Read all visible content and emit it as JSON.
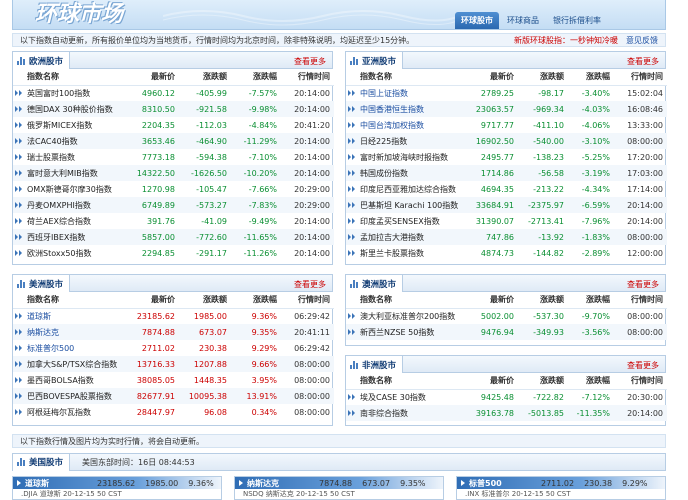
{
  "banner": {
    "logo": "环球市场",
    "tabs": [
      "环球股市",
      "环球商品",
      "银行拆借利率"
    ]
  },
  "notice": {
    "text": "以下指数自动更新，所有报价单位均为当地货币，行情时间均为北京时间，除非特殊说明，均延迟至少15分钟。",
    "link1": "新版环球股指：一秒钟知冷暖",
    "link2": "意见反馈"
  },
  "more_label": "查看更多",
  "headers": [
    "指数名称",
    "最新价",
    "涨跌额",
    "涨跌幅",
    "行情时间"
  ],
  "europe": {
    "title": "欧洲股市",
    "rows": [
      [
        "英国富时100指数",
        "4960.12",
        "-405.99",
        "-7.57%",
        "20:14:00"
      ],
      [
        "德国DAX 30种股价指数",
        "8310.50",
        "-921.58",
        "-9.98%",
        "20:14:00"
      ],
      [
        "俄罗斯MICEX指数",
        "2204.35",
        "-112.03",
        "-4.84%",
        "20:41:20"
      ],
      [
        "法CAC40指数",
        "3653.46",
        "-464.90",
        "-11.29%",
        "20:14:00"
      ],
      [
        "瑞士股票指数",
        "7773.18",
        "-594.38",
        "-7.10%",
        "20:14:00"
      ],
      [
        "富时意大利MIB指数",
        "14322.50",
        "-1626.50",
        "-10.20%",
        "20:14:00"
      ],
      [
        "OMX斯德哥尔摩30指数",
        "1270.98",
        "-105.47",
        "-7.66%",
        "20:29:00"
      ],
      [
        "丹麦OMXPHI指数",
        "6749.89",
        "-573.27",
        "-7.83%",
        "20:29:00"
      ],
      [
        "荷兰AEX综合指数",
        "391.76",
        "-41.09",
        "-9.49%",
        "20:14:00"
      ],
      [
        "西班牙IBEX指数",
        "5857.00",
        "-772.60",
        "-11.65%",
        "20:14:00"
      ],
      [
        "欧洲Stoxx50指数",
        "2294.85",
        "-291.17",
        "-11.26%",
        "20:14:00"
      ]
    ]
  },
  "asia": {
    "title": "亚洲股市",
    "rows": [
      [
        "中国上证指数",
        "2789.25",
        "-98.17",
        "-3.40%",
        "15:02:04"
      ],
      [
        "中国香港恒生指数",
        "23063.57",
        "-969.34",
        "-4.03%",
        "16:08:46"
      ],
      [
        "中国台湾加权指数",
        "9717.77",
        "-411.10",
        "-4.06%",
        "13:33:00"
      ],
      [
        "日经225指数",
        "16902.50",
        "-540.00",
        "-3.10%",
        "08:00:00"
      ],
      [
        "富时新加坡海峡时报指数",
        "2495.77",
        "-138.23",
        "-5.25%",
        "17:20:00"
      ],
      [
        "韩国成份指数",
        "1714.86",
        "-56.58",
        "-3.19%",
        "17:03:00"
      ],
      [
        "印度尼西亚雅加达综合指数",
        "4694.35",
        "-213.22",
        "-4.34%",
        "17:14:00"
      ],
      [
        "巴基斯坦 Karachi 100指数",
        "33684.91",
        "-2375.97",
        "-6.59%",
        "20:14:00"
      ],
      [
        "印度孟买SENSEX指数",
        "31390.07",
        "-2713.41",
        "-7.96%",
        "20:14:00"
      ],
      [
        "孟加拉吉大港指数",
        "747.86",
        "-13.92",
        "-1.83%",
        "08:00:00"
      ],
      [
        "斯里兰卡股票指数",
        "4874.73",
        "-144.82",
        "-2.89%",
        "12:00:00"
      ]
    ]
  },
  "america": {
    "title": "美洲股市",
    "rows": [
      [
        "道琼斯",
        "23185.62",
        "1985.00",
        "9.36%",
        "06:29:42"
      ],
      [
        "纳斯达克",
        "7874.88",
        "673.07",
        "9.35%",
        "20:41:11"
      ],
      [
        "标准普尔500",
        "2711.02",
        "230.38",
        "9.29%",
        "06:29:42"
      ],
      [
        "加拿大S&P/TSX综合指数",
        "13716.33",
        "1207.88",
        "9.66%",
        "08:00:00"
      ],
      [
        "墨西哥BOLSA指数",
        "38085.05",
        "1448.35",
        "3.95%",
        "08:00:00"
      ],
      [
        "巴西BOVESPA股票指数",
        "82677.91",
        "10095.38",
        "13.91%",
        "08:00:00"
      ],
      [
        "阿根廷梅尔瓦指数",
        "28447.97",
        "96.08",
        "0.34%",
        "08:00:00"
      ]
    ]
  },
  "australia": {
    "title": "澳洲股市",
    "rows": [
      [
        "澳大利亚标准普尔200指数",
        "5002.00",
        "-537.30",
        "-9.70%",
        "08:00:00"
      ],
      [
        "新西兰NZSE 50指数",
        "9476.94",
        "-349.93",
        "-3.56%",
        "08:00:00"
      ]
    ]
  },
  "africa": {
    "title": "非洲股市",
    "rows": [
      [
        "埃及CASE 30指数",
        "9425.48",
        "-722.82",
        "-7.12%",
        "20:30:00"
      ],
      [
        "南非综合指数",
        "39163.78",
        "-5013.85",
        "-11.35%",
        "20:14:00"
      ]
    ]
  },
  "notice2": "以下指数行情及图片均为实时行情，将会自动更新。",
  "usbar": {
    "title": "美国股市",
    "time": "美国东部时间：16日 08:44:53"
  },
  "quotes": [
    {
      "name": "道琼斯",
      "price": "23185.62",
      "change": "1985.00",
      "pct": "9.36%",
      "sub": ".DJIA   道琼斯   20-12-15 50 CST"
    },
    {
      "name": "纳斯达克",
      "price": "7874.88",
      "change": "673.07",
      "pct": "9.35%",
      "sub": "NSDQ   纳斯达克   20-12-15 50 CST"
    },
    {
      "name": "标普500",
      "price": "2711.02",
      "change": "230.38",
      "pct": "9.29%",
      "sub": ".INX   标准普尔   20-12-15 50 CST"
    }
  ],
  "colors": {
    "down": "#0a8f32",
    "up": "#c00000",
    "link": "#1b4ea1"
  }
}
